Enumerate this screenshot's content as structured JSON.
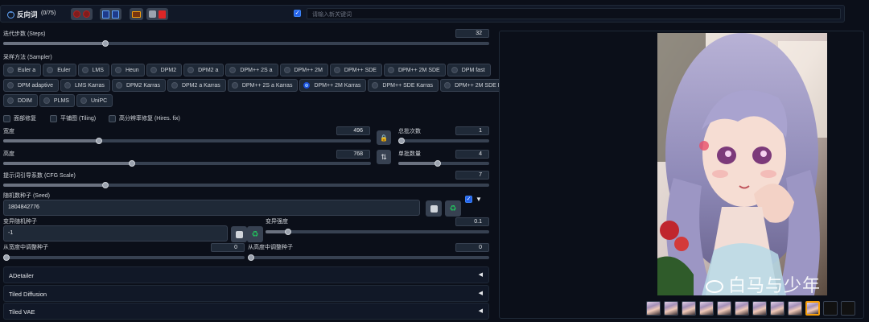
{
  "topbar": {
    "title": "反向词",
    "count": "(0/75)",
    "keyword_placeholder": "请输入新关键词",
    "keyword_checked": true
  },
  "steps": {
    "label": "迭代步数 (Steps)",
    "value": "32",
    "fraction": 0.21
  },
  "sampler": {
    "label": "采样方法 (Sampler)",
    "rows": [
      [
        "Euler a",
        "Euler",
        "LMS",
        "Heun",
        "DPM2",
        "DPM2 a",
        "DPM++ 2S a",
        "DPM++ 2M",
        "DPM++ SDE",
        "DPM++ 2M SDE",
        "DPM fast"
      ],
      [
        "DPM adaptive",
        "LMS Karras",
        "DPM2 Karras",
        "DPM2 a Karras",
        "DPM++ 2S a Karras",
        "DPM++ 2M Karras",
        "DPM++ SDE Karras",
        "DPM++ 2M SDE Karras"
      ],
      [
        "DDIM",
        "PLMS",
        "UniPC"
      ]
    ],
    "selected": "DPM++ 2M Karras"
  },
  "options": {
    "restore_faces": "面部修复",
    "tiling": "平铺图 (Tiling)",
    "hires_fix": "高分辨率修复 (Hires. fix)"
  },
  "width": {
    "label": "宽度",
    "value": "496",
    "fraction": 0.26
  },
  "height": {
    "label": "高度",
    "value": "768",
    "fraction": 0.35
  },
  "batch_count": {
    "label": "总批次数",
    "value": "1",
    "fraction": 0.0
  },
  "batch_size": {
    "label": "单批数量",
    "value": "4",
    "fraction": 0.43
  },
  "cfg": {
    "label": "提示词引导系数 (CFG Scale)",
    "value": "7",
    "fraction": 0.21
  },
  "seed": {
    "label": "随机数种子 (Seed)",
    "value": "1804842776",
    "extra_checked": true
  },
  "variation_seed": {
    "label": "变异随机种子",
    "value": "-1"
  },
  "variation_strength": {
    "label": "变异强度",
    "value": "0.1",
    "fraction": 0.1
  },
  "resize_w": {
    "label": "从宽度中调整种子",
    "value": "0",
    "fraction": 0.0
  },
  "resize_h": {
    "label": "从高度中调整种子",
    "value": "0",
    "fraction": 0.0
  },
  "accordions": [
    "ADetailer",
    "Tiled Diffusion",
    "Tiled VAE"
  ],
  "watermark": "白马与少年",
  "gallery": {
    "thumbnail_count": 12,
    "selected_index": 9
  },
  "colors": {
    "accent": "#3b82f6",
    "background": "#0b0f19",
    "panel": "#1f2937",
    "warning": "#f59e0b"
  }
}
